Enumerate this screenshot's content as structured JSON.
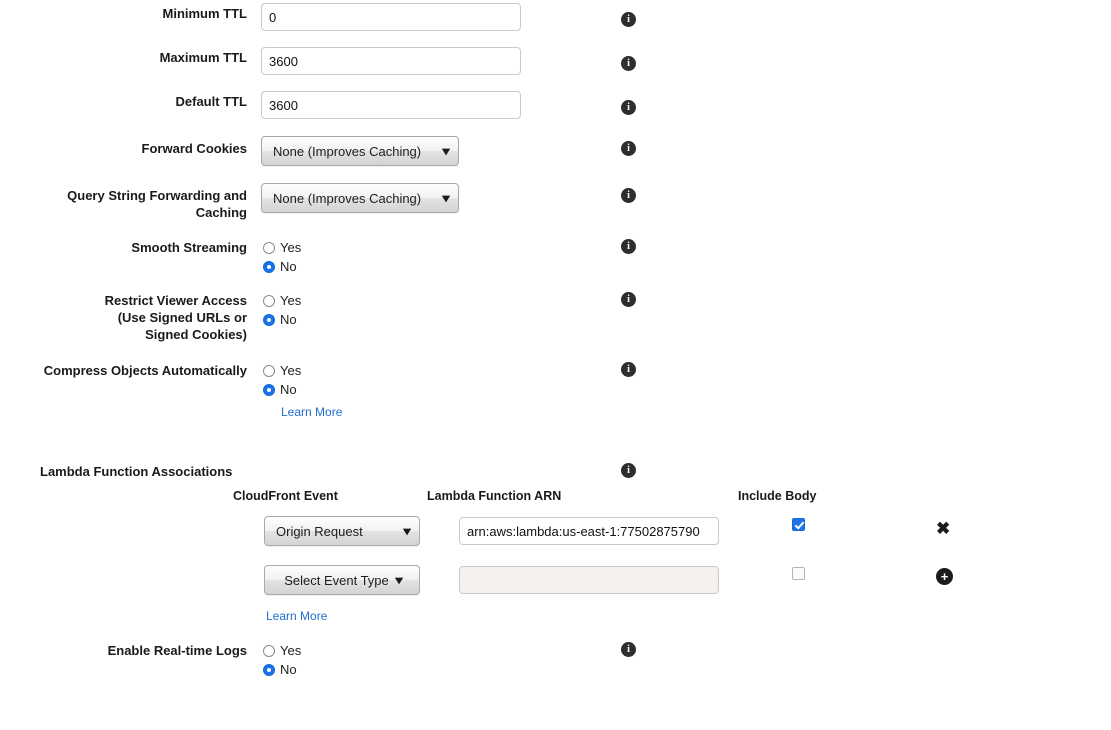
{
  "form": {
    "fields": [
      {
        "label": "Minimum TTL",
        "value": "0"
      },
      {
        "label": "Maximum TTL",
        "value": "3600"
      },
      {
        "label": "Default TTL",
        "value": "3600"
      }
    ],
    "selects": [
      {
        "label": "Forward Cookies",
        "value": "None (Improves Caching)"
      },
      {
        "label": "Query String Forwarding and Caching",
        "label_line1": "Query String Forwarding and",
        "label_line2": "Caching",
        "value": "None (Improves Caching)"
      }
    ],
    "radio_groups": [
      {
        "label": "Smooth Streaming",
        "options": [
          {
            "label": "Yes",
            "selected": false
          },
          {
            "label": "No",
            "selected": true
          }
        ]
      },
      {
        "label": "Restrict Viewer Access (Use Signed URLs or Signed Cookies)",
        "label_line1": "Restrict Viewer Access",
        "label_line2": "(Use Signed URLs or",
        "label_line3": "Signed Cookies)",
        "options": [
          {
            "label": "Yes",
            "selected": false
          },
          {
            "label": "No",
            "selected": true
          }
        ]
      },
      {
        "label": "Compress Objects Automatically",
        "options": [
          {
            "label": "Yes",
            "selected": false
          },
          {
            "label": "No",
            "selected": true
          }
        ]
      },
      {
        "label": "Enable Real-time Logs",
        "options": [
          {
            "label": "Yes",
            "selected": false
          },
          {
            "label": "No",
            "selected": true
          }
        ]
      }
    ],
    "links": {
      "compress_learn_more": "Learn More",
      "lambda_learn_more": "Learn More"
    }
  },
  "lambda": {
    "section_label": "Lambda Function Associations",
    "columns": {
      "event": "CloudFront Event",
      "arn": "Lambda Function ARN",
      "include_body": "Include Body"
    },
    "rows": [
      {
        "event": "Origin Request",
        "arn": "arn:aws:lambda:us-east-1:77502875790",
        "arn_placeholder": "",
        "include_body": true,
        "arn_disabled": false,
        "action": "remove",
        "action_glyph": "✖"
      },
      {
        "event": "Select Event Type",
        "arn": "",
        "arn_placeholder": "",
        "include_body": false,
        "arn_disabled": true,
        "action": "add",
        "action_glyph": "✚"
      }
    ]
  },
  "icons": {
    "info": "i",
    "chevron_down": "⌄",
    "remove": "✖",
    "add": "✚"
  },
  "colors": {
    "accent_blue": "#1a73e8",
    "link_blue": "#1f6fce",
    "info_dark": "#2e2e2e",
    "disabled_field": "#f4f1ee"
  }
}
